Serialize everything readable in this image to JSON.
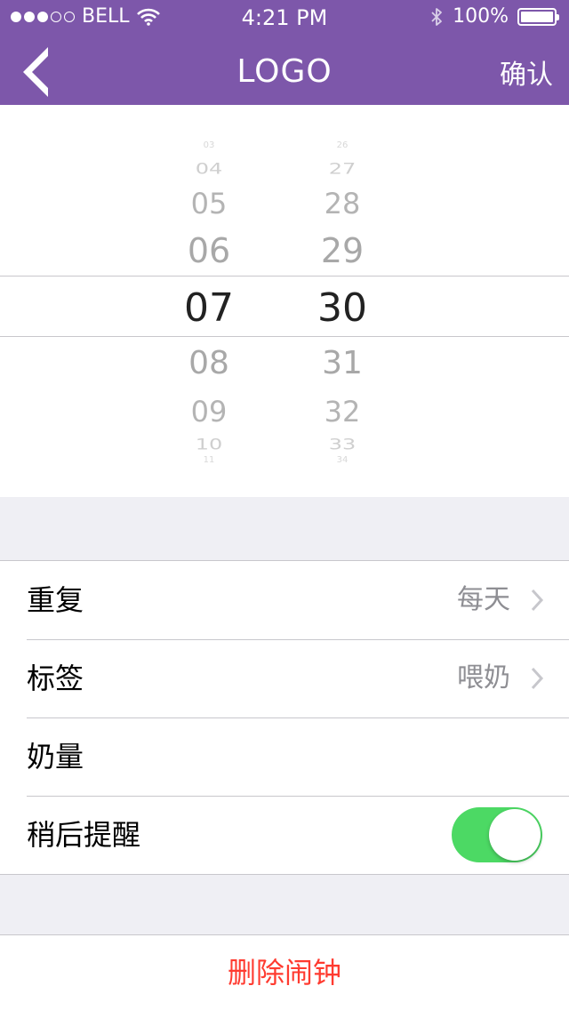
{
  "status_bar": {
    "carrier": "BELL",
    "signal_dots_filled": 3,
    "signal_dots_total": 5,
    "wifi_icon": "wifi-icon",
    "time": "4:21 PM",
    "bluetooth_icon": "bluetooth-icon",
    "battery_percent": "100%",
    "battery_level": 1.0
  },
  "navbar": {
    "back_icon": "back-arrow-icon",
    "title": "LOGO",
    "confirm_label": "确认",
    "background_color": "#7d57aa"
  },
  "picker": {
    "hours": [
      "03",
      "04",
      "05",
      "06",
      "07",
      "08",
      "09",
      "10",
      "11"
    ],
    "minutes": [
      "26",
      "27",
      "28",
      "29",
      "30",
      "31",
      "32",
      "33",
      "34"
    ],
    "selected_hour": "07",
    "selected_minute": "30"
  },
  "settings": {
    "repeat": {
      "label": "重复",
      "value": "每天"
    },
    "tag": {
      "label": "标签",
      "value": "喂奶"
    },
    "amount": {
      "label": "奶量"
    },
    "snooze": {
      "label": "稍后提醒",
      "enabled": true,
      "toggle_color": "#4cd964"
    }
  },
  "delete_label": "删除闹钟",
  "delete_color": "#ff3b30"
}
